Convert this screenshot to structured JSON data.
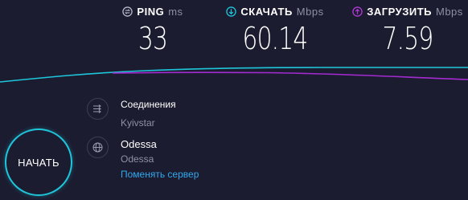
{
  "metrics": {
    "ping": {
      "label": "PING",
      "unit": "ms",
      "value": "33",
      "icon": "ping-icon",
      "color": "#b6b6c8"
    },
    "download": {
      "label": "СКАЧАТЬ",
      "unit": "Mbps",
      "value": "60.14",
      "icon": "download-arrow-icon",
      "color": "#1ec6db"
    },
    "upload": {
      "label": "ЗАГРУЗИТЬ",
      "unit": "Mbps",
      "value": "7.59",
      "icon": "upload-arrow-icon",
      "color": "#b03ad6"
    }
  },
  "start_button": {
    "label": "НАЧАТЬ",
    "color": "#1ec6db"
  },
  "connection": {
    "title": "Соединения",
    "provider": "Kyivstar",
    "icon": "connections-icon"
  },
  "server": {
    "city": "Odessa",
    "sponsor": "Odessa",
    "change_label": "Поменять сервер",
    "icon": "globe-icon"
  },
  "colors": {
    "background": "#1c1c30",
    "download_line": "#1ec6db",
    "upload_line": "#a32bd0",
    "link": "#32a8ef"
  }
}
